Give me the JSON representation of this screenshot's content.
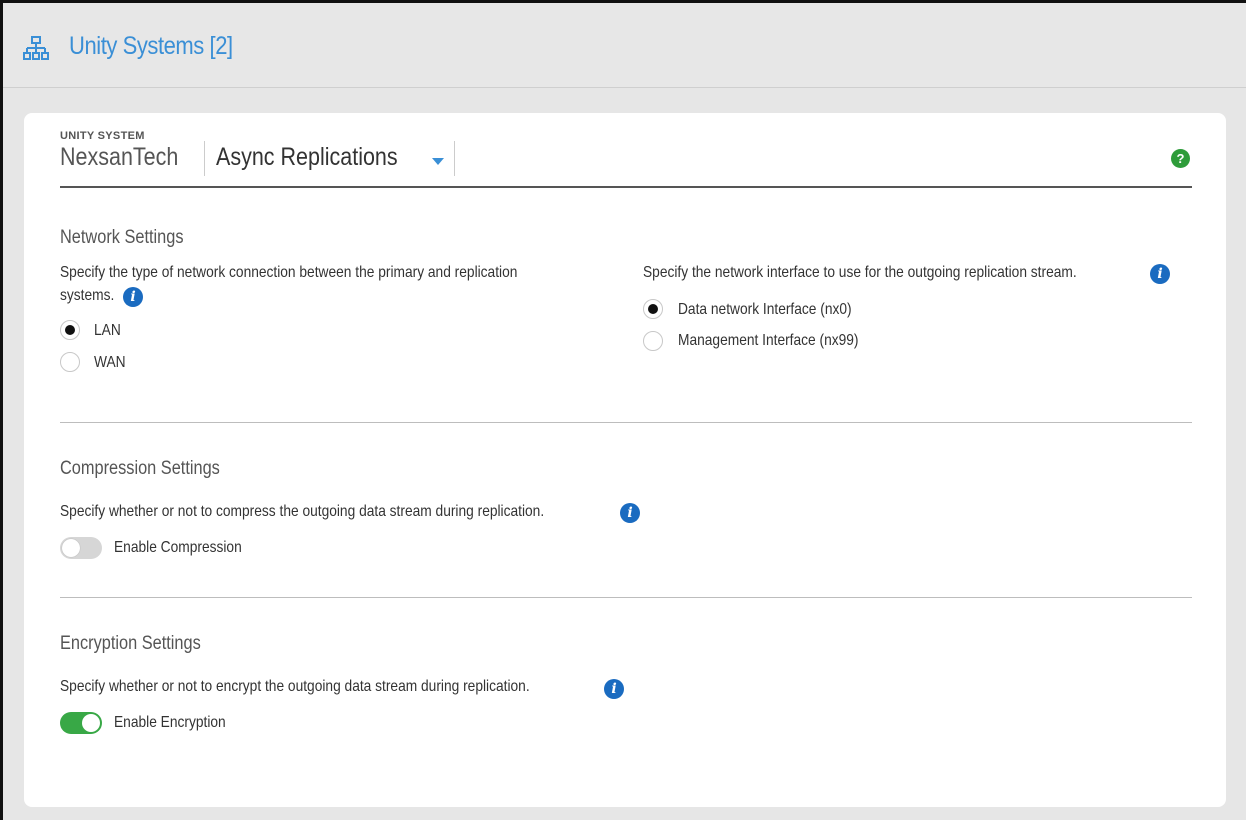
{
  "topbar": {
    "icon": "network-hierarchy-icon",
    "title": "Unity Systems [2]"
  },
  "header": {
    "caption": "UNITY SYSTEM",
    "system_name": "NexsanTech",
    "selected_view": "Async Replications",
    "help_icon": "question-icon",
    "help_label": "?"
  },
  "network": {
    "title": "Network Settings",
    "type_desc_line1": "Specify the type of network connection between the primary and replication",
    "type_desc_line2": "systems.",
    "type_options": [
      {
        "label": "LAN",
        "selected": true
      },
      {
        "label": "WAN",
        "selected": false
      }
    ],
    "iface_desc": "Specify the network interface to use for the outgoing replication stream.",
    "iface_options": [
      {
        "label": "Data network Interface (nx0)",
        "selected": true
      },
      {
        "label": "Management Interface (nx99)",
        "selected": false
      }
    ]
  },
  "compression": {
    "title": "Compression Settings",
    "desc": "Specify whether or not to compress the outgoing data stream during replication.",
    "toggle_label": "Enable Compression",
    "enabled": false
  },
  "encryption": {
    "title": "Encryption Settings",
    "desc": "Specify whether or not to encrypt the outgoing data stream during replication.",
    "toggle_label": "Enable Encryption",
    "enabled": true
  },
  "info_glyph": "i",
  "colors": {
    "accent_blue": "#3a8fd6",
    "info_blue": "#1a6bc0",
    "help_green": "#2e9c3a",
    "toggle_on": "#38a846"
  }
}
